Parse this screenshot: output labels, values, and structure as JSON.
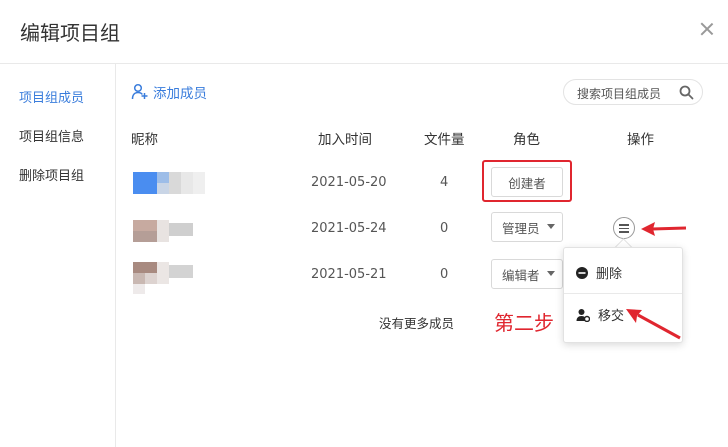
{
  "dialog": {
    "title": "编辑项目组"
  },
  "sidebar": {
    "items": [
      {
        "label": "项目组成员",
        "active": true
      },
      {
        "label": "项目组信息",
        "active": false
      },
      {
        "label": "删除项目组",
        "active": false
      }
    ]
  },
  "toolbar": {
    "add_member_label": "添加成员",
    "search_placeholder": "搜索项目组成员"
  },
  "table": {
    "headers": {
      "nickname": "昵称",
      "joined": "加入时间",
      "files": "文件量",
      "role": "角色",
      "actions": "操作"
    },
    "rows": [
      {
        "date": "2021-05-20",
        "files": "4",
        "role": "创建者"
      },
      {
        "date": "2021-05-24",
        "files": "0",
        "role": "管理员"
      },
      {
        "date": "2021-05-21",
        "files": "0",
        "role": "编辑者"
      }
    ],
    "footer": "没有更多成员"
  },
  "menu": {
    "delete_label": "删除",
    "transfer_label": "移交"
  },
  "annotation": {
    "step_label": "第二步"
  },
  "colors": {
    "accent": "#3a7ddc",
    "highlight_red": "#e0262f"
  }
}
